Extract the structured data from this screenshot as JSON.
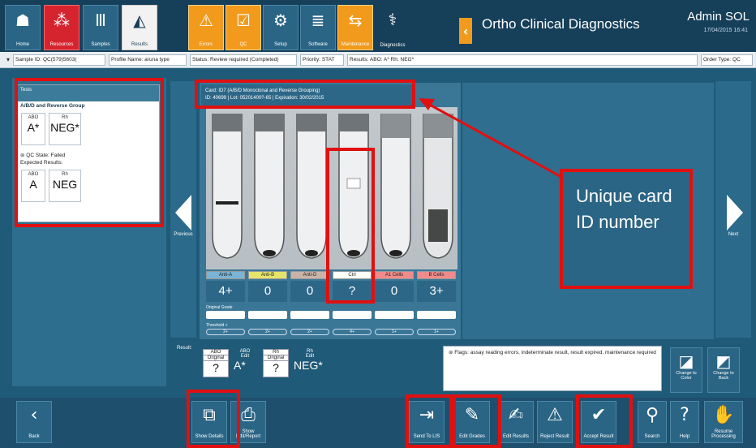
{
  "topbar": {
    "nav": [
      {
        "label": "Home",
        "icon": "home-icon",
        "glyph": "☗",
        "style": ""
      },
      {
        "label": "Resources",
        "icon": "resources-icon",
        "glyph": "⁂",
        "style": "red"
      },
      {
        "label": "Samples",
        "icon": "samples-icon",
        "glyph": "Ⅲ",
        "style": ""
      },
      {
        "label": "Results",
        "icon": "results-icon",
        "glyph": "◭",
        "style": "active"
      },
      {
        "label": "Errors",
        "icon": "warning-icon",
        "glyph": "⚠",
        "style": "orange"
      },
      {
        "label": "QC",
        "icon": "qc-check-icon",
        "glyph": "☑",
        "style": "orange"
      },
      {
        "label": "Setup",
        "icon": "setup-icon",
        "glyph": "⚙",
        "style": ""
      },
      {
        "label": "Software",
        "icon": "software-icon",
        "glyph": "≣",
        "style": ""
      },
      {
        "label": "Maintenance",
        "icon": "maintenance-icon",
        "glyph": "⇆",
        "style": "orange"
      },
      {
        "label": "Diagnostics",
        "icon": "diagnostics-icon",
        "glyph": "⚕",
        "style": "bare"
      }
    ],
    "app_title": "Ortho Clinical Diagnostics",
    "user": "Admin SOL",
    "datetime": "17/04/2015 16:41"
  },
  "infostrip": {
    "chips": [
      "Sample ID: QC(579)5603(",
      "Profile Name: aruna type",
      "Status: Review required (Completed)",
      "Priority: STAT",
      "Results: ABO:    A*   Rh:   NEG*",
      "Order Type: QC"
    ]
  },
  "tests": {
    "header": "Tests",
    "title": "A/B/D and Reverse Group",
    "abo_label": "ABO",
    "rh_label": "Rh",
    "abo_value": "A*",
    "rh_value": "NEG*",
    "qc_status": "QC State: Failed",
    "expected_label": "Expected Results:",
    "exp_abo_label": "ABO",
    "exp_rh_label": "Rh",
    "exp_abo_value": "A",
    "exp_rh_value": "NEG"
  },
  "card": {
    "line1": "Card: ID7 (A/B/D Monoclonal and Reverse Grouping)",
    "line2": "ID: 40699 | Lot: 05201400?-65 | Expiration: 30/02/2015",
    "cells": [
      {
        "label": "Anti-A",
        "value": "4+",
        "color": "#7ab3d3",
        "threshold": "2+"
      },
      {
        "label": "Anti-B",
        "value": "0",
        "color": "#e6e36b",
        "threshold": "2+"
      },
      {
        "label": "Anti-D",
        "value": "0",
        "color": "#c9b3a8",
        "threshold": "2+"
      },
      {
        "label": "Ctrl",
        "value": "?",
        "color": "#ffffff",
        "threshold": "4+"
      },
      {
        "label": "A1 Cells",
        "value": "0",
        "color": "#f08b8b",
        "threshold": "1+"
      },
      {
        "label": "B Cells",
        "value": "3+",
        "color": "#f08b8b",
        "threshold": "1+"
      }
    ],
    "original_grade_label": "Original Grade",
    "threshold_label": "Threshold +"
  },
  "nav_arrows": {
    "previous": "Previous",
    "next": "Next"
  },
  "result": {
    "label": "Result:",
    "abo_orig_h": "ABO",
    "abo_orig_s": "Original",
    "abo_orig_v": "?",
    "abo_edit_h": "ABO",
    "abo_edit_s": "Edit",
    "abo_edit_v": "A*",
    "rh_orig_h": "Rh",
    "rh_orig_s": "Original",
    "rh_orig_v": "?",
    "rh_edit_h": "Rh",
    "rh_edit_s": "Edit",
    "rh_edit_v": "NEG*",
    "flags": "Flags: assay reading errors, indeterminate result, result expired, maintenance required",
    "change_color": "Change to Color",
    "change_back": "Change to Back"
  },
  "bottombar": {
    "back": "Back",
    "show_details": "Show Details",
    "show_edit_report": "Show Edit/Report",
    "send_to_lis": "Send To LIS",
    "edit_grades": "Edit Grades",
    "edit_results": "Edit Results",
    "reject_result": "Reject Result",
    "accept_result": "Accept Result",
    "search": "Search",
    "help": "Help",
    "resume_processing": "Resume Processing"
  },
  "callout": {
    "text": "Unique card ID number"
  },
  "colors": {
    "annotation": "#e01010",
    "accent_orange": "#f29a1b",
    "accent_red": "#d6242f",
    "panel_blue": "#1f5a78"
  }
}
